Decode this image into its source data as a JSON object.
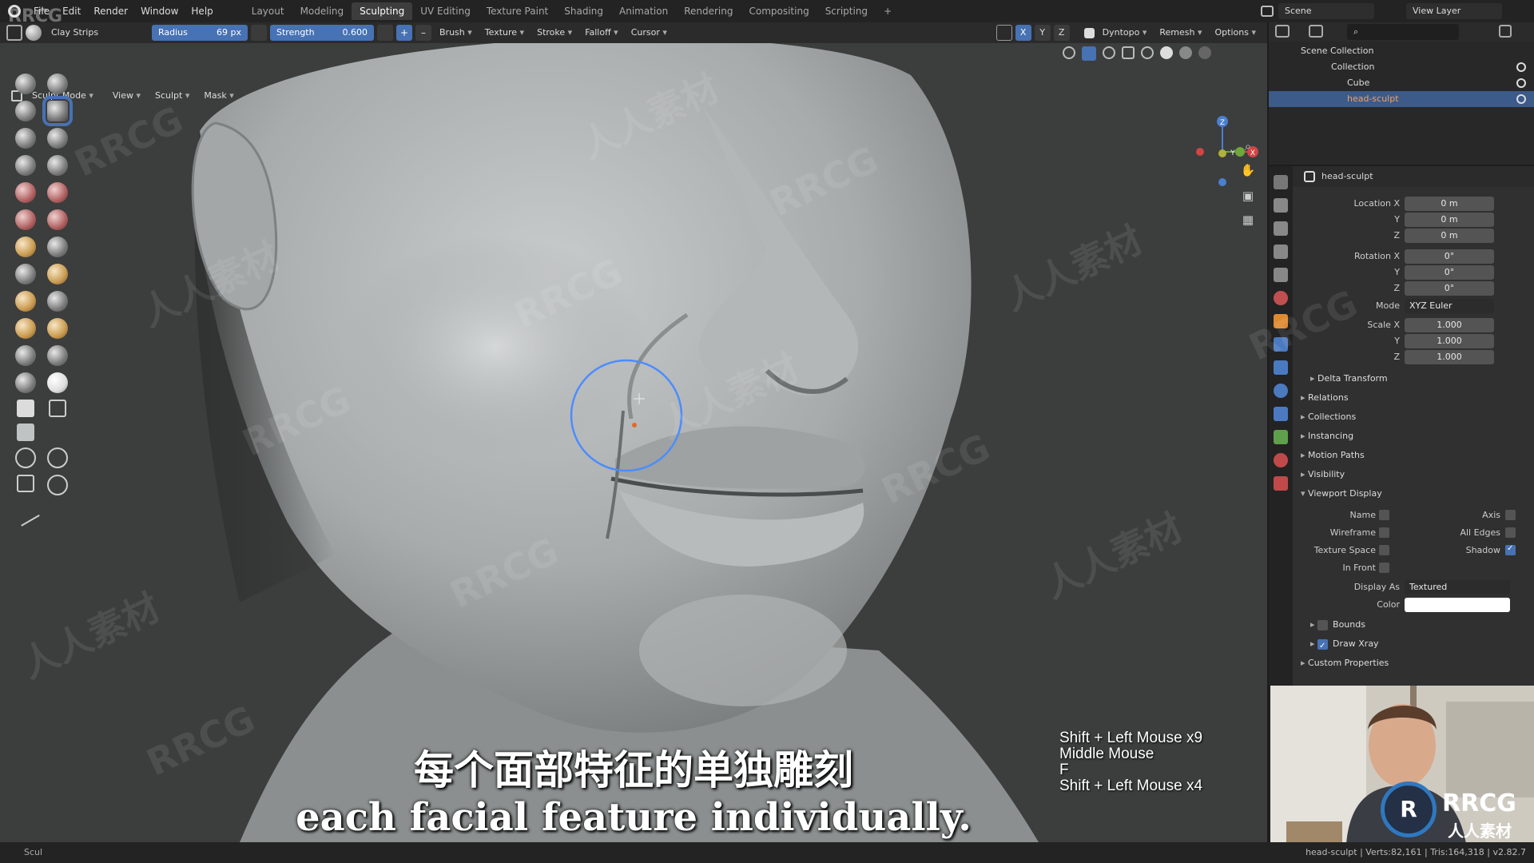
{
  "menu": [
    "File",
    "Edit",
    "Render",
    "Window",
    "Help"
  ],
  "workspace_tabs": [
    {
      "label": "Layout",
      "active": false
    },
    {
      "label": "Modeling",
      "active": false
    },
    {
      "label": "Sculpting",
      "active": true
    },
    {
      "label": "UV Editing",
      "active": false
    },
    {
      "label": "Texture Paint",
      "active": false
    },
    {
      "label": "Shading",
      "active": false
    },
    {
      "label": "Animation",
      "active": false
    },
    {
      "label": "Rendering",
      "active": false
    },
    {
      "label": "Compositing",
      "active": false
    },
    {
      "label": "Scripting",
      "active": false
    }
  ],
  "add_workspace_label": "+",
  "scene": {
    "label": "Scene",
    "view_layer": "View Layer"
  },
  "tool_header": {
    "brush_name": "Clay Strips",
    "radius_label": "Radius",
    "radius_value": "69 px",
    "strength_label": "Strength",
    "strength_value": "0.600",
    "plus": "+",
    "minus": "–",
    "dropdowns": [
      "Brush",
      "Texture",
      "Stroke",
      "Falloff",
      "Cursor"
    ],
    "axes": [
      "X",
      "Y",
      "Z"
    ],
    "dyntopo": "Dyntopo",
    "remesh": "Remesh",
    "options": "Options"
  },
  "mode_header": {
    "mode": "Sculpt Mode",
    "menus": [
      "View",
      "Sculpt",
      "Mask"
    ]
  },
  "gizmo": {
    "x": "X",
    "y": "Y",
    "z": "Z"
  },
  "outliner": {
    "scene_collection": "Scene Collection",
    "collection": "Collection",
    "items": [
      {
        "label": "Cube",
        "selected": false
      },
      {
        "label": "head-sculpt",
        "selected": true
      }
    ]
  },
  "properties": {
    "object_name": "head-sculpt",
    "location": {
      "label_x": "Location X",
      "label_y": "Y",
      "label_z": "Z",
      "x": "0 m",
      "y": "0 m",
      "z": "0 m"
    },
    "rotation": {
      "label_x": "Rotation X",
      "label_y": "Y",
      "label_z": "Z",
      "x": "0°",
      "y": "0°",
      "z": "0°"
    },
    "mode": {
      "label": "Mode",
      "value": "XYZ Euler"
    },
    "scale": {
      "label_x": "Scale X",
      "label_y": "Y",
      "label_z": "Z",
      "x": "1.000",
      "y": "1.000",
      "z": "1.000"
    },
    "panels": [
      "Delta Transform",
      "Relations",
      "Collections",
      "Instancing",
      "Motion Paths",
      "Visibility"
    ],
    "viewport_display": {
      "title": "Viewport Display",
      "name": "Name",
      "axis": "Axis",
      "wireframe": "Wireframe",
      "all_edges": "All Edges",
      "texture_space": "Texture Space",
      "shadow": "Shadow",
      "shadow_checked": true,
      "in_front": "In Front",
      "display_as_label": "Display As",
      "display_as_value": "Textured",
      "color_label": "Color",
      "color_value": "#ffffff",
      "bounds": "Bounds",
      "draw_xray": "Draw Xray",
      "draw_xray_checked": true
    },
    "custom_properties": "Custom Properties"
  },
  "subtitles": {
    "cn": "每个面部特征的单独雕刻",
    "en": "each facial feature individually."
  },
  "key_overlay": [
    "Shift + Left Mouse x9",
    "Middle Mouse",
    "F",
    "Shift + Left Mouse x4"
  ],
  "status_bar": {
    "left": "Scul",
    "right": "head-sculpt | Verts:82,161 | Tris:164,318 | v2.82.7"
  },
  "watermarks": {
    "rrcg": "RRCG",
    "cn": "人人素材"
  },
  "colors": {
    "accent": "#4772b3",
    "viewport_bg": "#3c3d3d",
    "sculpt_gray": "#a9adad",
    "selection": "#3c5a8a"
  }
}
